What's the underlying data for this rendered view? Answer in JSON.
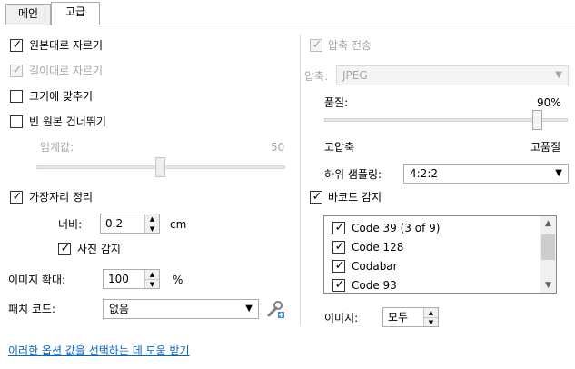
{
  "tabs": [
    {
      "label": "메인"
    },
    {
      "label": "고급"
    }
  ],
  "left": {
    "crop_original": {
      "label": "원본대로 자르기",
      "checked": true
    },
    "crop_length": {
      "label": "길이대로 자르기",
      "checked": true,
      "disabled": true
    },
    "fit_size": {
      "label": "크기에 맞추기",
      "checked": false
    },
    "skip_blank": {
      "label": "빈 원본 건너뛰기",
      "checked": false
    },
    "threshold": {
      "label": "임계값:",
      "value": "50",
      "level": 50
    },
    "edge_cleanup": {
      "label": "가장자리 정리",
      "checked": true
    },
    "width": {
      "label": "너비:",
      "value": "0.2",
      "unit": "cm"
    },
    "photo_detect": {
      "label": "사진 감지",
      "checked": true
    },
    "image_zoom": {
      "label": "이미지 확대:",
      "value": "100",
      "unit": "%"
    },
    "patch_code": {
      "label": "패치 코드:",
      "value": "없음"
    },
    "help_link": "이러한 옵션 값을 선택하는 데 도움 받기"
  },
  "right": {
    "compress_transfer": {
      "label": "압축 전송",
      "checked": true,
      "disabled": true
    },
    "compression": {
      "label": "압축:",
      "value": "JPEG"
    },
    "quality": {
      "label": "품질:",
      "value": "90%",
      "level": 90,
      "low_label": "고압축",
      "high_label": "고품질"
    },
    "subsampling": {
      "label": "하위 샘플링:",
      "value": "4:2:2"
    },
    "barcode_detect": {
      "label": "바코드 감지",
      "checked": true
    },
    "barcode_list": [
      {
        "label": "Code 39 (3 of 9)",
        "checked": true
      },
      {
        "label": "Code 128",
        "checked": true
      },
      {
        "label": "Codabar",
        "checked": true
      },
      {
        "label": "Code 93",
        "checked": true
      }
    ],
    "image": {
      "label": "이미지:",
      "value": "모두"
    }
  },
  "icons": {
    "wrench": "wrench-plus-icon",
    "check": "check-icon",
    "dropdown": "chevron-down-icon"
  }
}
